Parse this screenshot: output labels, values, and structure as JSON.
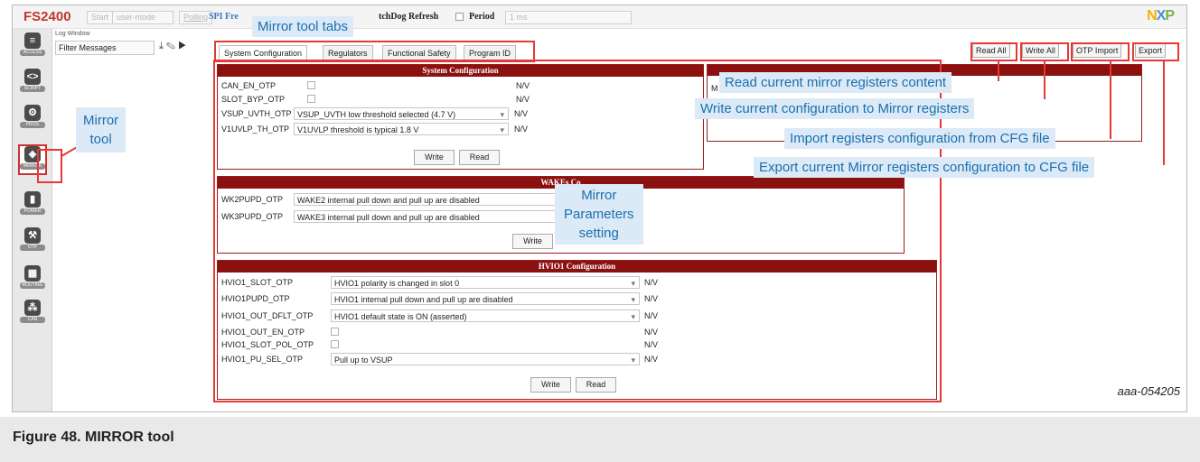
{
  "toolbar": {
    "brand": "FS2400",
    "start_label": "Start",
    "mode_label": "user-mode",
    "polling_label": "Polling",
    "spi_label": "SPI Fre",
    "watchdog_label": "tchDog Refresh",
    "period_label": "Period",
    "period_value": "1 ms"
  },
  "logo": {
    "n": "N",
    "x": "X",
    "p": "P"
  },
  "sidebar": {
    "items": [
      {
        "label": "ACCESS",
        "icon": "database-icon"
      },
      {
        "label": "SCRIPT",
        "icon": "code-icon"
      },
      {
        "label": "PROG",
        "icon": "gear-icon"
      },
      {
        "label": "MIRROR",
        "icon": "mirror-icon"
      },
      {
        "label": "POWER",
        "icon": "battery-icon"
      },
      {
        "label": "OTP",
        "icon": "hammer-icon"
      },
      {
        "label": "ROUTING",
        "icon": "grid-icon"
      },
      {
        "label": "CAN",
        "icon": "network-icon"
      }
    ]
  },
  "log": {
    "title": "Log Window",
    "filter": "Filter Messages"
  },
  "tabs": [
    {
      "label": "System Configuration"
    },
    {
      "label": "Regulators"
    },
    {
      "label": "Functional Safety"
    },
    {
      "label": "Program ID"
    }
  ],
  "actions": {
    "read_all": "Read All",
    "write_all": "Write All",
    "otp_import": "OTP Import",
    "export": "Export"
  },
  "system_config": {
    "title": "System Configuration",
    "rows": [
      {
        "label": "CAN_EN_OTP",
        "value": "",
        "status": "N/V"
      },
      {
        "label": "SLOT_BYP_OTP",
        "value": "",
        "status": "N/V"
      },
      {
        "label": "VSUP_UVTH_OTP",
        "value": "VSUP_UVTH low threshold selected (4.7 V)",
        "status": "N/V"
      },
      {
        "label": "V1UVLP_TH_OTP",
        "value": "V1UVLP threshold is typical 1.8 V",
        "status": "N/V"
      }
    ],
    "write": "Write",
    "read": "Read"
  },
  "clock_config": {
    "label_fragment": "M"
  },
  "wakes_config": {
    "title": "WAKEs Co",
    "rows": [
      {
        "label": "WK2PUPD_OTP",
        "value": "WAKE2 internal pull down and pull up are disabled"
      },
      {
        "label": "WK3PUPD_OTP",
        "value": "WAKE3 internal pull down and pull up are disabled"
      }
    ],
    "write": "Write"
  },
  "hvio_config": {
    "title": "HVIO1 Configuration",
    "rows": [
      {
        "label": "HVIO1_SLOT_OTP",
        "value": "HVIO1 polarity is changed in slot 0",
        "status": "N/V",
        "control": "select"
      },
      {
        "label": "HVIO1PUPD_OTP",
        "value": "HVIO1 internal pull down and pull up are disabled",
        "status": "N/V",
        "control": "select"
      },
      {
        "label": "HVIO1_OUT_DFLT_OTP",
        "value": "HVIO1 default state is ON (asserted)",
        "status": "N/V",
        "control": "select"
      },
      {
        "label": "HVIO1_OUT_EN_OTP",
        "value": "",
        "status": "N/V",
        "control": "checkbox"
      },
      {
        "label": "HVIO1_SLOT_POL_OTP",
        "value": "",
        "status": "N/V",
        "control": "checkbox"
      },
      {
        "label": "HVIO1_PU_SEL_OTP",
        "value": "Pull up to VSUP",
        "status": "N/V",
        "control": "select"
      }
    ],
    "write": "Write",
    "read": "Read"
  },
  "callouts": {
    "tabs": "Mirror tool tabs",
    "tool_line1": "Mirror",
    "tool_line2": "tool",
    "read_all": "Read current mirror registers content",
    "write_all": "Write current configuration to Mirror registers",
    "otp_import": "Import registers configuration from CFG file",
    "export": "Export current Mirror registers configuration to CFG file",
    "params_line1": "Mirror",
    "params_line2": "Parameters",
    "params_line3": "setting"
  },
  "figure": {
    "id": "aaa-054205",
    "caption": "Figure 48. MIRROR tool"
  },
  "colors": {
    "panel_header": "#8b1111",
    "highlight": "#e53935",
    "callout_bg": "#dbeaf6",
    "callout_text": "#1b6fb0"
  }
}
